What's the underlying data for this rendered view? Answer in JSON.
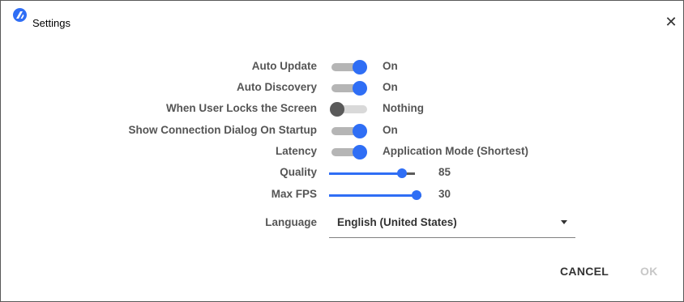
{
  "window": {
    "title": "Settings",
    "icon": "app-logo-icon",
    "close_glyph": "✕"
  },
  "settings": {
    "auto_update": {
      "label": "Auto Update",
      "enabled": true,
      "value": "On"
    },
    "auto_discovery": {
      "label": "Auto Discovery",
      "enabled": true,
      "value": "On"
    },
    "lock_screen": {
      "label": "When User Locks the Screen",
      "enabled": false,
      "value": "Nothing"
    },
    "show_connection": {
      "label": "Show Connection Dialog On Startup",
      "enabled": true,
      "value": "On"
    },
    "latency": {
      "label": "Latency",
      "enabled": true,
      "value": "Application Mode (Shortest)"
    },
    "quality": {
      "label": "Quality",
      "value": "85",
      "fraction": 0.85
    },
    "max_fps": {
      "label": "Max FPS",
      "value": "30",
      "fraction": 1.0
    },
    "language": {
      "label": "Language",
      "value": "English (United States)"
    }
  },
  "buttons": {
    "cancel": "CANCEL",
    "ok": "OK"
  },
  "colors": {
    "accent": "#2f6ef5",
    "disabled_text": "#c7c7c7"
  }
}
